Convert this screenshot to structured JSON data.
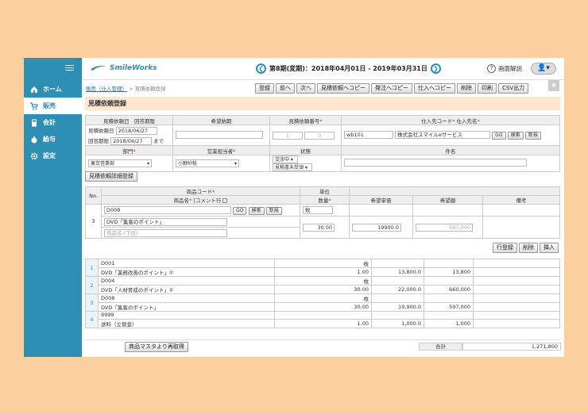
{
  "sidebar": {
    "items": [
      {
        "label": "ホーム",
        "icon": "home-icon"
      },
      {
        "label": "販売",
        "icon": "cart-icon"
      },
      {
        "label": "会計",
        "icon": "calculator-icon"
      },
      {
        "label": "給与",
        "icon": "money-bag-icon"
      },
      {
        "label": "設定",
        "icon": "gear-icon"
      }
    ]
  },
  "header": {
    "logo": "SmileWorks",
    "period": "第8期(変期)：2018年04月01日 - 2019年03月31日",
    "help": "画面解説"
  },
  "breadcrumb": {
    "parent": "販売（仕入管理）",
    "sep": " > ",
    "current": "見積依頼登録"
  },
  "toolbar": [
    "登録",
    "前へ",
    "次へ",
    "見積依頼へコピー",
    "発注へコピー",
    "仕入へコピー",
    "削除",
    "印刷",
    "CSV出力"
  ],
  "page_title": "見積依頼登録",
  "form": {
    "h_date": "見積依頼日　回答期限",
    "h_want": "希望納期",
    "h_no": "見積依頼番号",
    "h_sup": "仕入先コード",
    "h_supname": "仕入先名",
    "lbl_req_date": "見積依頼日",
    "req_date": "2018/06/27",
    "lbl_ans_date": "回答期限",
    "ans_date": "2018/06/27",
    "made": "まで",
    "no1": "1",
    "no2": "0",
    "sup_code": "wb101",
    "sup_name": "株式会社スマイルeサービス",
    "h_dept": "部門",
    "h_staff": "営業担当者",
    "h_status": "状態",
    "h_subject": "件名",
    "dept": "東京営業部",
    "staff": "小野紗枝",
    "status1": "交渉中",
    "status2": "見積書未受領",
    "go": "GO",
    "search": "検索",
    "new": "新規"
  },
  "detail": {
    "button": "見積依頼詳細登録",
    "h_no": "No.",
    "h_code": "商品コード",
    "h_name": "商品名",
    "h_comment": "[コメント行",
    "h_unit": "単位",
    "h_qty": "数量",
    "h_price": "希望単価",
    "h_amount": "希望額",
    "h_note": "備考",
    "row_no": "3",
    "code": "D008",
    "unit": "枚",
    "name": "DVD「集客のポイント」",
    "sub_ph": "商品名 (下段)",
    "qty": "30.00",
    "price": "19900.0",
    "amount": "597,000"
  },
  "row_actions": [
    "行登録",
    "削除",
    "挿入"
  ],
  "lines": [
    {
      "no": "1",
      "code": "D001",
      "name": "DVD「業務改善のポイント」①",
      "unit": "枚",
      "qty": "1.00",
      "price": "13,800.0",
      "amount": "13,800"
    },
    {
      "no": "2",
      "code": "D004",
      "name": "DVD「人材育成のポイント」①",
      "unit": "枚",
      "qty": "30.00",
      "price": "22,000.0",
      "amount": "660,000"
    },
    {
      "no": "3",
      "code": "D008",
      "name": "DVD「集客のポイント」",
      "unit": "枚",
      "qty": "30.00",
      "price": "19,900.0",
      "amount": "597,000"
    },
    {
      "no": "4",
      "code": "9999",
      "name": "送料（立替金）",
      "unit": "",
      "qty": "1.00",
      "price": "1,000.0",
      "amount": "1,000"
    }
  ],
  "footer": {
    "reload": "商品マスタより再取得",
    "total_label": "合計",
    "total": "1,271,800"
  },
  "colors": {
    "accent": "#2d8fb4",
    "bg": "#fbcf9e"
  }
}
